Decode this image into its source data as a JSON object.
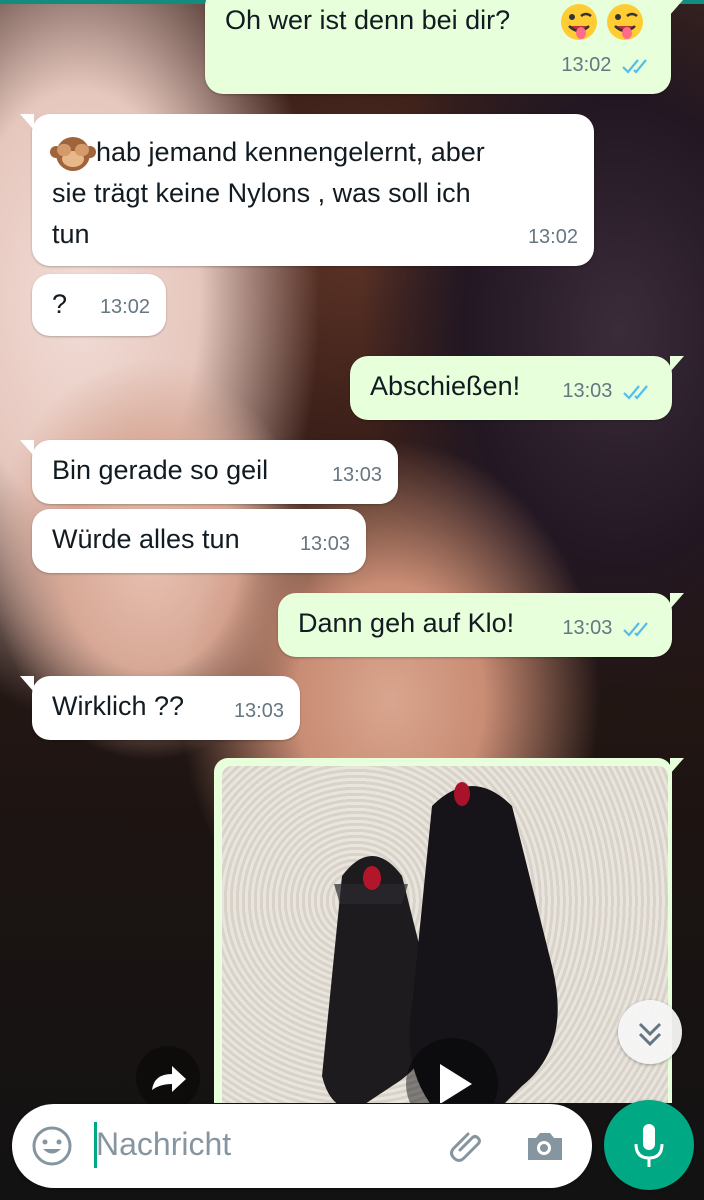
{
  "colors": {
    "accent": "#00a884",
    "outgoing_bubble": "#e7ffdb",
    "incoming_bubble": "#ffffff",
    "read_ticks": "#53bdeb",
    "timestamp": "#667781"
  },
  "messages": [
    {
      "direction": "out",
      "text": "Oh wer ist denn bei dir?",
      "emoji": "winking-tongue-face-emoji x2",
      "time": "13:02",
      "status": "read"
    },
    {
      "direction": "in",
      "text_lines": [
        "hab jemand kennengelernt, aber",
        "sie trägt keine Nylons , was soll ich",
        "tun"
      ],
      "emoji": "see-no-evil-monkey-emoji",
      "time": "13:02"
    },
    {
      "direction": "in",
      "text": "?",
      "time": "13:02"
    },
    {
      "direction": "out",
      "text": "Abschießen!",
      "time": "13:03",
      "status": "read"
    },
    {
      "direction": "in",
      "text": "Bin gerade so geil",
      "time": "13:03"
    },
    {
      "direction": "in",
      "text": "Würde alles tun",
      "time": "13:03"
    },
    {
      "direction": "out",
      "text": "Dann geh auf Klo!",
      "time": "13:03",
      "status": "read"
    },
    {
      "direction": "in",
      "text": "Wirklich ??",
      "time": "13:03"
    },
    {
      "direction": "out",
      "type": "video",
      "icon": "play-icon"
    }
  ],
  "composer": {
    "placeholder": "Nachricht",
    "emoji_icon": "emoji-icon",
    "attach_icon": "paperclip-icon",
    "camera_icon": "camera-icon",
    "mic_icon": "microphone-icon"
  },
  "floating": {
    "forward_icon": "forward-icon",
    "scroll_down_icon": "double-chevron-down-icon"
  }
}
